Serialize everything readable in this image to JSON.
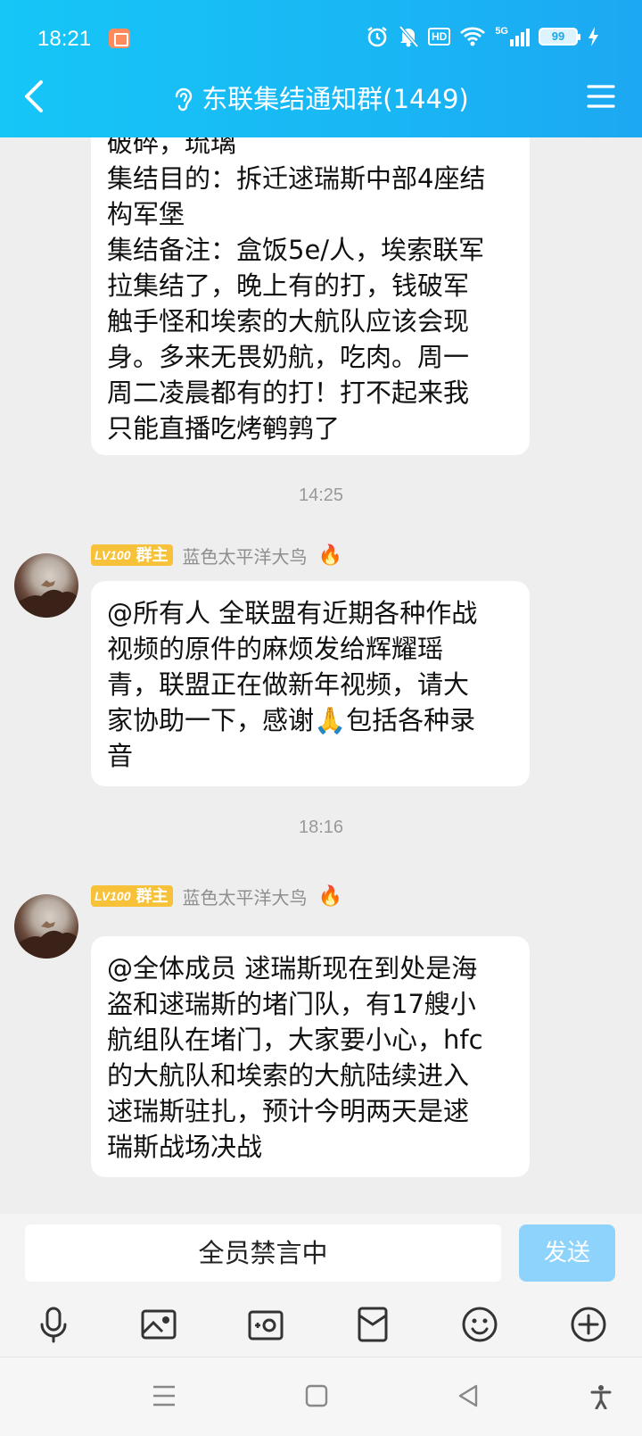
{
  "status_bar": {
    "time": "18:21",
    "hd": "HD",
    "network": "5G",
    "battery": "99"
  },
  "header": {
    "title": "东联集结通知群(1449)"
  },
  "messages": {
    "first": {
      "lines": [
        "破碎，琉璃",
        "集结目的：拆迁逑瑞斯中部4座结",
        "构军堡",
        "集结备注：盒饭5e/人，埃索联军",
        "拉集结了，晚上有的打，钱破军",
        "触手怪和埃索的大航队应该会现",
        "身。多来无畏奶航，吃肉。周一",
        "周二凌晨都有的打！打不起来我",
        "只能直播吃烤鹌鹑了"
      ]
    },
    "time1": "14:25",
    "second": {
      "level": "LV100",
      "role": "群主",
      "sender": "蓝色太平洋大鸟",
      "lines": [
        "@所有人 全联盟有近期各种作战",
        "视频的原件的麻烦发给辉耀瑶",
        "青，联盟正在做新年视频，请大",
        "家协助一下，感谢🙏包括各种录",
        "音"
      ]
    },
    "time2": "18:16",
    "third": {
      "level": "LV100",
      "role": "群主",
      "sender": "蓝色太平洋大鸟",
      "lines": [
        "@全体成员 逑瑞斯现在到处是海",
        "盗和逑瑞斯的堵门队，有17艘小",
        "航组队在堵门，大家要小心，hfc",
        "的大航队和埃索的大航陆续进入",
        "逑瑞斯驻扎，预计今明两天是逑",
        "瑞斯战场决战"
      ]
    }
  },
  "input": {
    "placeholder": "全员禁言中",
    "send_label": "发送"
  },
  "colors": {
    "header_start": "#16c6f7",
    "header_end": "#1ca8f2",
    "send_disabled": "#8ed3fb",
    "badge": "#f7c23a"
  }
}
